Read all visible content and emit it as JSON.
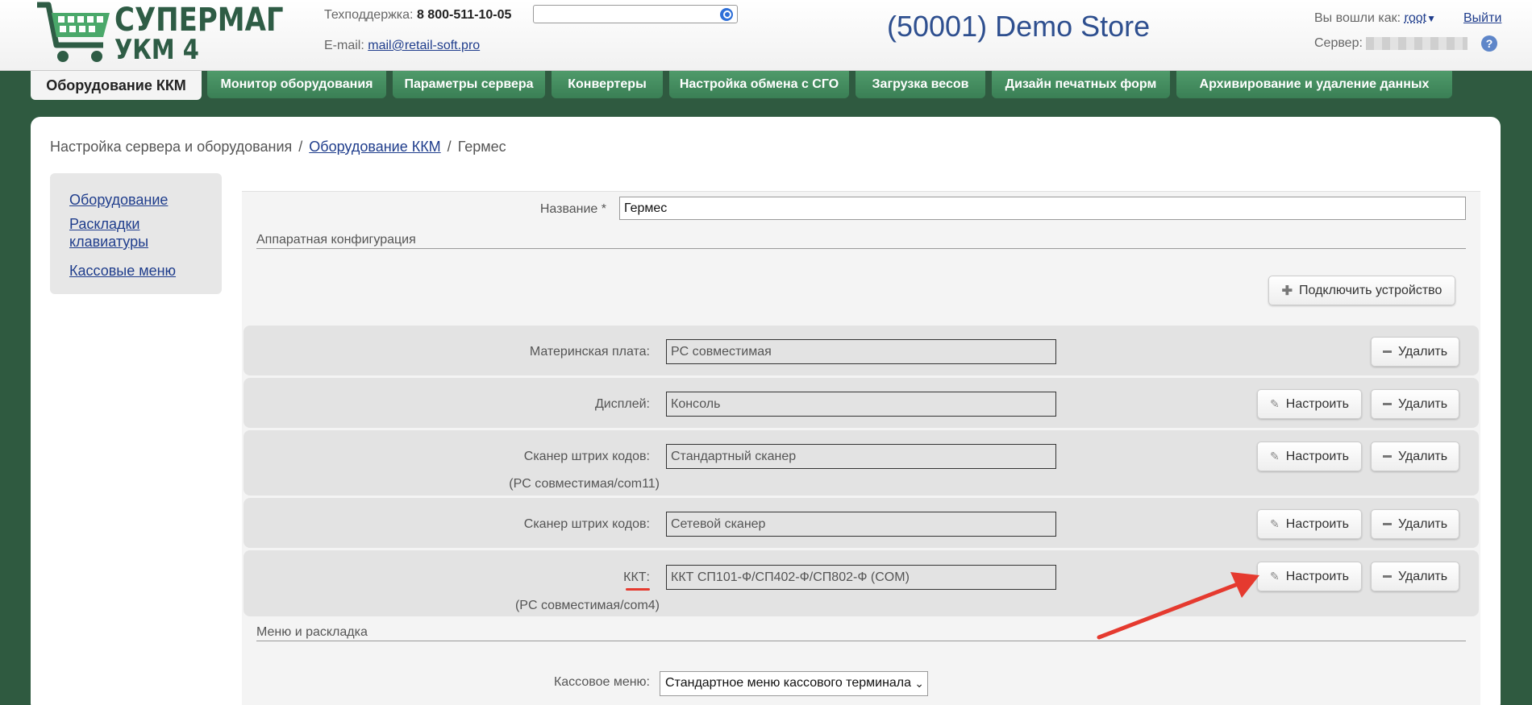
{
  "header": {
    "logo_line1": "СУПЕРМАГ",
    "logo_line2": "УКМ 4",
    "support_label": "Техподдержка:",
    "support_phone": "8 800-511-10-05",
    "email_label": "E-mail:",
    "email_value": "mail@retail-soft.pro",
    "search_value": "",
    "store_title": "(50001) Demo Store",
    "logged_in_label": "Вы вошли как:",
    "user": "root",
    "logout": "Выйти",
    "server_label": "Сервер:",
    "help": "?"
  },
  "tabs": [
    {
      "label": "Оборудование ККМ"
    },
    {
      "label": "Монитор оборудования"
    },
    {
      "label": "Параметры сервера"
    },
    {
      "label": "Конвертеры"
    },
    {
      "label": "Настройка обмена с СГО"
    },
    {
      "label": "Загрузка весов"
    },
    {
      "label": "Дизайн печатных форм"
    },
    {
      "label": "Архивирование и удаление данных"
    }
  ],
  "breadcrumb": {
    "root": "Настройка сервера и оборудования",
    "parent": "Оборудование ККМ",
    "current": "Гермес"
  },
  "sidebar": {
    "items": [
      {
        "label": "Оборудование"
      },
      {
        "label": "Раскладки клавиатуры"
      },
      {
        "label": "Кассовые меню"
      }
    ]
  },
  "form": {
    "name_label": "Название *",
    "name_value": "Гермес",
    "hardware_section": "Аппаратная конфигурация",
    "add_device": "Подключить устройство",
    "configure": "Настроить",
    "delete": "Удалить",
    "devices": [
      {
        "label": "Материнская плата:",
        "value": "PC совместимая",
        "sub": ""
      },
      {
        "label": "Дисплей:",
        "value": "Консоль",
        "sub": ""
      },
      {
        "label": "Сканер штрих кодов:",
        "value": "Стандартный сканер",
        "sub": "(PC совместимая/com11)"
      },
      {
        "label": "Сканер штрих кодов:",
        "value": "Сетевой сканер",
        "sub": ""
      },
      {
        "label": "ККТ:",
        "value": "ККТ СП101-Ф/СП402-Ф/СП802-Ф (COM)",
        "sub": "(PC совместимая/com4)"
      }
    ],
    "menu_section": "Меню и раскладка",
    "menu_label": "Кассовое меню:",
    "menu_value": "Стандартное меню кассового терминала"
  },
  "colors": {
    "accent_green": "#3a7f55",
    "link_blue": "#1f3d8c",
    "arrow_red": "#e53a2f"
  }
}
